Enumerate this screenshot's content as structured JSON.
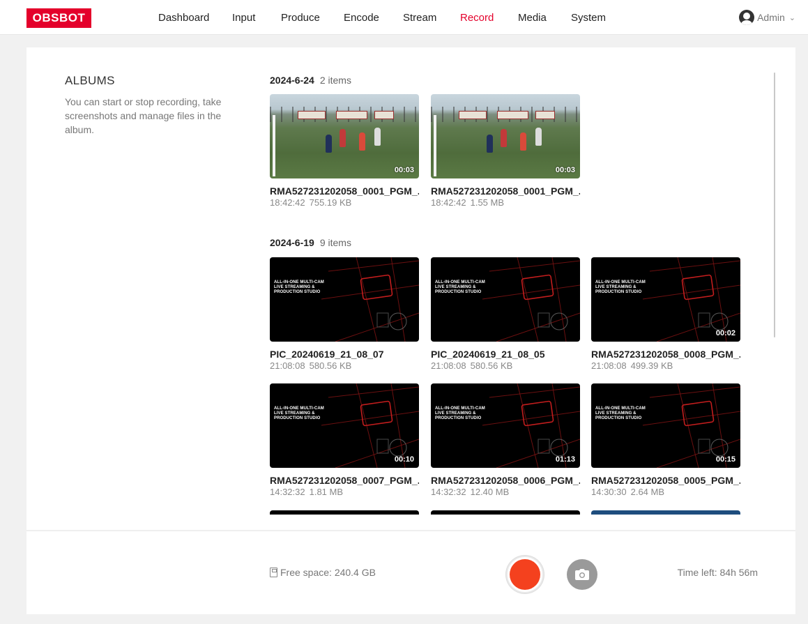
{
  "brand": {
    "logo": "OBSBOT",
    "accent": "#e4002b"
  },
  "nav": {
    "items": [
      {
        "label": "Dashboard",
        "active": false
      },
      {
        "label": "Input",
        "active": false
      },
      {
        "label": "Produce",
        "active": false
      },
      {
        "label": "Encode",
        "active": false
      },
      {
        "label": "Stream",
        "active": false
      },
      {
        "label": "Record",
        "active": true
      },
      {
        "label": "Media",
        "active": false
      },
      {
        "label": "System",
        "active": false
      }
    ],
    "user": {
      "label": "Admin",
      "icon": "user-avatar-icon"
    }
  },
  "albums": {
    "title": "ALBUMS",
    "description": "You can start or stop recording, take screenshots and manage files in the album."
  },
  "groups": [
    {
      "date": "2024-6-24",
      "count": "2 items",
      "files": [
        {
          "name": "RMA527231202058_0001_PGM_...",
          "time": "18:42:42",
          "size": "755.19 KB",
          "duration": "00:03",
          "thumb": "soccer"
        },
        {
          "name": "RMA527231202058_0001_PGM_...",
          "time": "18:42:42",
          "size": "1.55 MB",
          "duration": "00:03",
          "thumb": "soccer"
        }
      ]
    },
    {
      "date": "2024-6-19",
      "count": "9 items",
      "files": [
        {
          "name": "PIC_20240619_21_08_07",
          "time": "21:08:08",
          "size": "580.56 KB",
          "duration": "",
          "thumb": "promo"
        },
        {
          "name": "PIC_20240619_21_08_05",
          "time": "21:08:08",
          "size": "580.56 KB",
          "duration": "",
          "thumb": "promo"
        },
        {
          "name": "RMA527231202058_0008_PGM_...",
          "time": "21:08:08",
          "size": "499.39 KB",
          "duration": "00:02",
          "thumb": "promo"
        },
        {
          "name": "RMA527231202058_0007_PGM_...",
          "time": "14:32:32",
          "size": "1.81 MB",
          "duration": "00:10",
          "thumb": "promo"
        },
        {
          "name": "RMA527231202058_0006_PGM_...",
          "time": "14:32:32",
          "size": "12.40 MB",
          "duration": "01:13",
          "thumb": "promo"
        },
        {
          "name": "RMA527231202058_0005_PGM_...",
          "time": "14:30:30",
          "size": "2.64 MB",
          "duration": "00:15",
          "thumb": "promo"
        }
      ]
    }
  ],
  "promo_text": [
    "ALL-IN-ONE MULTI-CAM",
    "LIVE STREAMING &",
    "PRODUCTION STUDIO"
  ],
  "footer": {
    "free_space": "Free space: 240.4 GB",
    "time_left": "Time left: 84h 56m",
    "record_color": "#f4411e"
  }
}
